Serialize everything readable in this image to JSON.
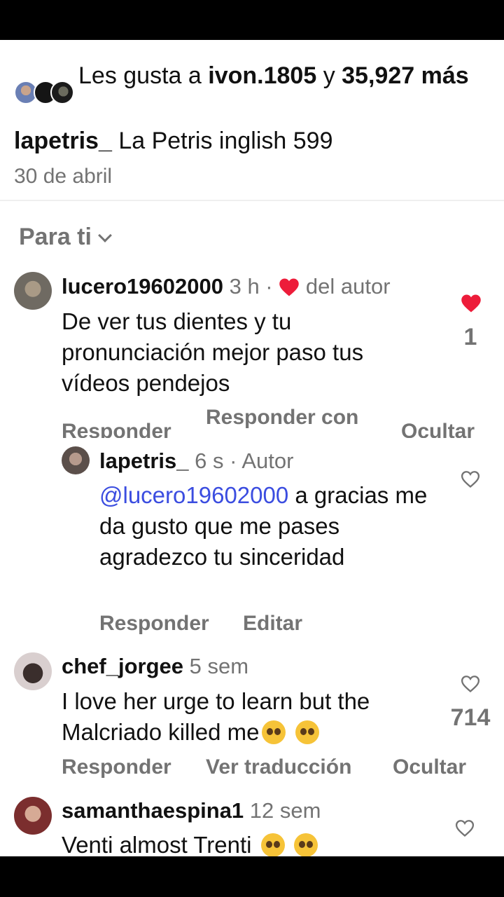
{
  "likes": {
    "prefix": "Les gusta a",
    "user": "ivon.1805",
    "joiner": "y",
    "count": "35,927",
    "suffix": "más"
  },
  "post": {
    "username": "lapetris_",
    "caption": "La Petris inglish 599",
    "date": "30 de abril"
  },
  "filter": {
    "label": "Para ti"
  },
  "comments": [
    {
      "username": "lucero19602000",
      "time": "3 h ·",
      "author_badge": "del autor",
      "text": "De ver tus dientes y tu pronunciación mejor paso tus vídeos pendejos",
      "likes": "1",
      "actions": [
        "Responder",
        "Responder con",
        "Ocultar"
      ]
    },
    {
      "username": "lapetris_",
      "time": "6 s · Autor",
      "mention": "@lucero19602000",
      "text": "a gracias me da gusto que me pases agradezco tu sinceridad",
      "actions": [
        "Responder",
        "Editar"
      ]
    },
    {
      "username": "chef_jorgee",
      "time": "5 sem",
      "text": "I love her urge to learn but the Malcriado killed me",
      "likes": "714",
      "actions": [
        "Responder",
        "Ver traducción",
        "Ocultar"
      ]
    },
    {
      "username": "samanthaespina1",
      "time": "12 sem",
      "text": "Venti almost Trenti"
    }
  ],
  "colors": {
    "heart": "#ed1c3a",
    "mention": "#3b4de0",
    "muted": "#737373"
  }
}
